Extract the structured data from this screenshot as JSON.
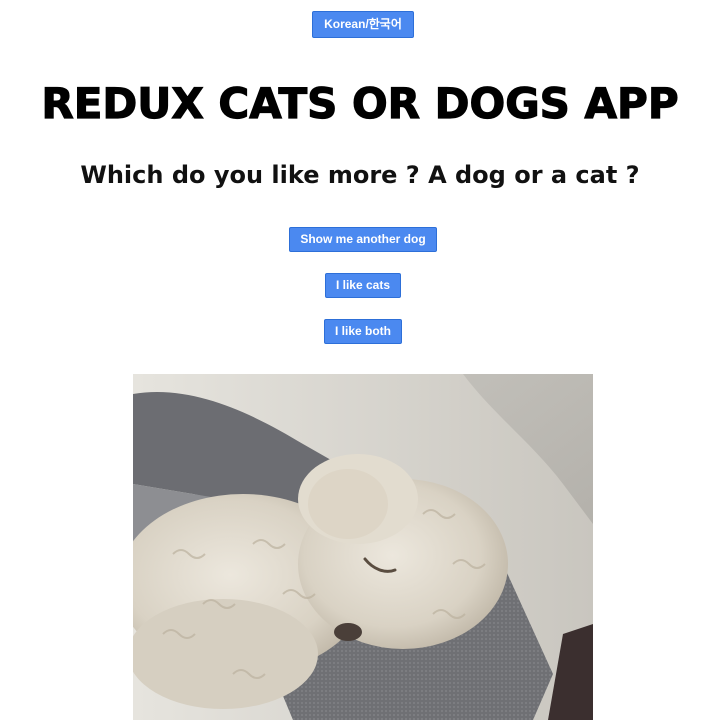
{
  "header": {
    "language_button": "Korean/한국어"
  },
  "main": {
    "title": "REDUX CATS OR DOGS APP",
    "question": "Which do you like more ? A dog or a cat ?",
    "buttons": {
      "another_dog": "Show me another dog",
      "like_cats": "I like cats",
      "like_both": "I like both"
    }
  },
  "image": {
    "subject": "dog-photo"
  },
  "colors": {
    "button_bg": "#4b89f0",
    "button_text": "#ffffff",
    "text": "#000000"
  }
}
